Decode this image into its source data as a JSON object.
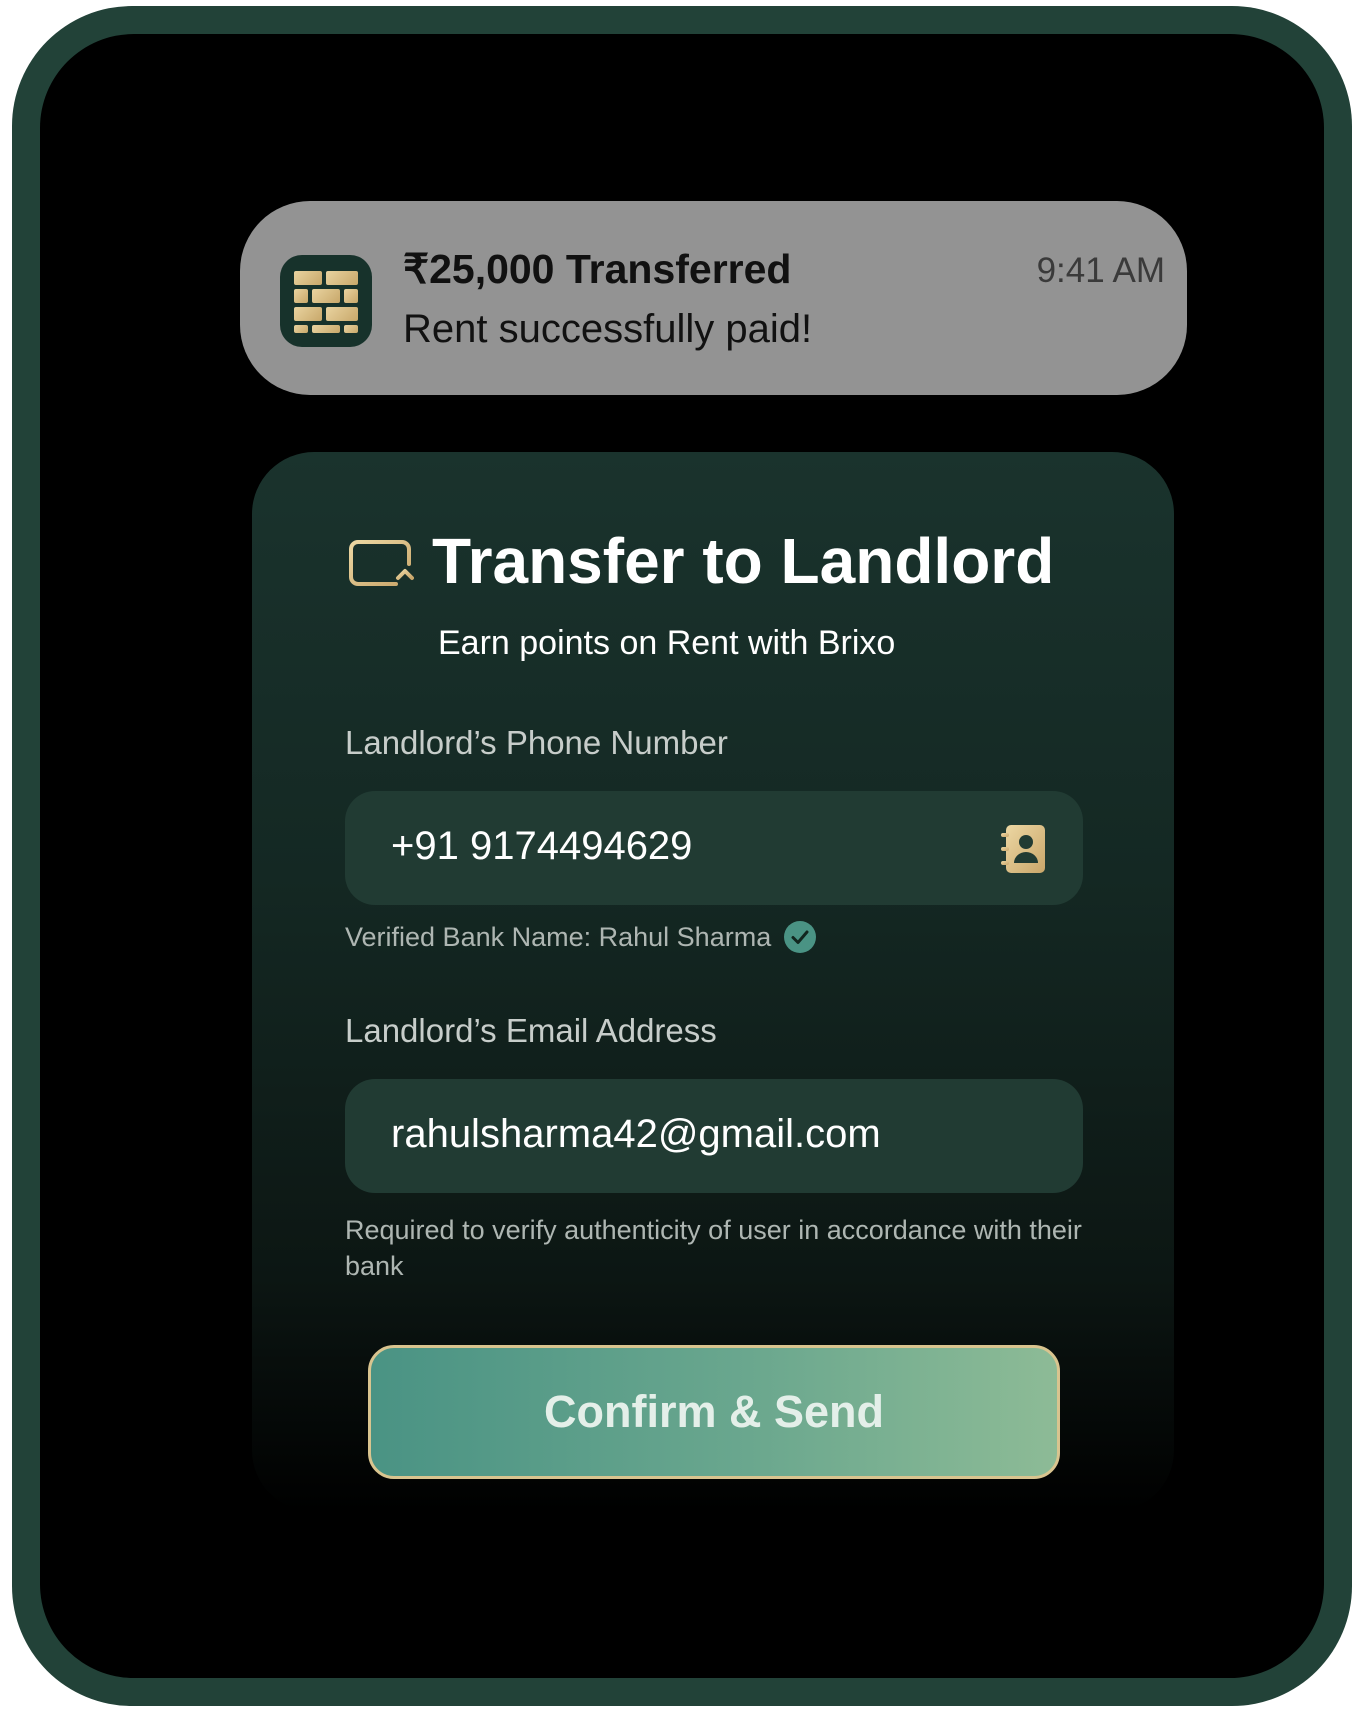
{
  "notification": {
    "title": "₹25,000 Transferred",
    "body": "Rent successfully paid!",
    "time": "9:41 AM",
    "icon": "brick-wall-app-icon"
  },
  "card": {
    "icon": "card-transfer-icon",
    "title": "Transfer to Landlord",
    "subtitle": "Earn points on Rent with Brixo",
    "phone": {
      "label": "Landlord’s Phone Number",
      "value": "+91 9174494629",
      "icon": "contact-book-icon"
    },
    "verified": {
      "text": "Verified Bank Name: Rahul Sharma",
      "icon": "check-circle-icon"
    },
    "email": {
      "label": "Landlord’s Email Address",
      "value": "rahulsharma42@gmail.com",
      "helper": "Required to verify authenticity of user in accordance with their bank"
    },
    "button_label": "Confirm & Send"
  },
  "colors": {
    "frame": "#224238",
    "notification_bg": "#939393",
    "card_bg": "#1a332d",
    "field_bg": "#213b33",
    "accent_gold": "#d9c48f",
    "button_start": "#4a9384",
    "button_end": "#8dbb96",
    "verified_green": "#4a9384"
  }
}
